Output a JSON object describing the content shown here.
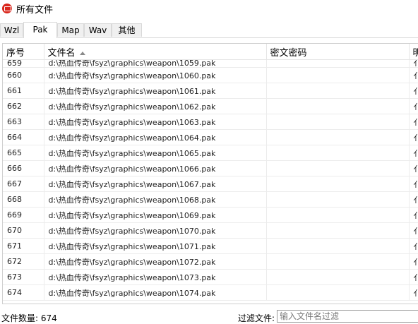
{
  "window": {
    "title": "所有文件",
    "app_icon": "app-logo-icon"
  },
  "tabs": [
    {
      "label": "Wzl",
      "active": false
    },
    {
      "label": "Pak",
      "active": true
    },
    {
      "label": "Map",
      "active": false
    },
    {
      "label": "Wav",
      "active": false
    },
    {
      "label": "其他",
      "active": false
    }
  ],
  "table": {
    "columns": [
      "序号",
      "文件名",
      "密文密码",
      "明"
    ],
    "sort_indicator": "sort-ascending-icon",
    "rows": [
      {
        "index": "659",
        "file": "d:\\热血传奇\\fsyz\\graphics\\weapon\\1059.pak",
        "password": "",
        "extra": "亻"
      },
      {
        "index": "660",
        "file": "d:\\热血传奇\\fsyz\\graphics\\weapon\\1060.pak",
        "password": "",
        "extra": "亻"
      },
      {
        "index": "661",
        "file": "d:\\热血传奇\\fsyz\\graphics\\weapon\\1061.pak",
        "password": "",
        "extra": "亻"
      },
      {
        "index": "662",
        "file": "d:\\热血传奇\\fsyz\\graphics\\weapon\\1062.pak",
        "password": "",
        "extra": "亻"
      },
      {
        "index": "663",
        "file": "d:\\热血传奇\\fsyz\\graphics\\weapon\\1063.pak",
        "password": "",
        "extra": "亻"
      },
      {
        "index": "664",
        "file": "d:\\热血传奇\\fsyz\\graphics\\weapon\\1064.pak",
        "password": "",
        "extra": "亻"
      },
      {
        "index": "665",
        "file": "d:\\热血传奇\\fsyz\\graphics\\weapon\\1065.pak",
        "password": "",
        "extra": "亻"
      },
      {
        "index": "666",
        "file": "d:\\热血传奇\\fsyz\\graphics\\weapon\\1066.pak",
        "password": "",
        "extra": "亻"
      },
      {
        "index": "667",
        "file": "d:\\热血传奇\\fsyz\\graphics\\weapon\\1067.pak",
        "password": "",
        "extra": "亻"
      },
      {
        "index": "668",
        "file": "d:\\热血传奇\\fsyz\\graphics\\weapon\\1068.pak",
        "password": "",
        "extra": "亻"
      },
      {
        "index": "669",
        "file": "d:\\热血传奇\\fsyz\\graphics\\weapon\\1069.pak",
        "password": "",
        "extra": "亻"
      },
      {
        "index": "670",
        "file": "d:\\热血传奇\\fsyz\\graphics\\weapon\\1070.pak",
        "password": "",
        "extra": "亻"
      },
      {
        "index": "671",
        "file": "d:\\热血传奇\\fsyz\\graphics\\weapon\\1071.pak",
        "password": "",
        "extra": "亻"
      },
      {
        "index": "672",
        "file": "d:\\热血传奇\\fsyz\\graphics\\weapon\\1072.pak",
        "password": "",
        "extra": "亻"
      },
      {
        "index": "673",
        "file": "d:\\热血传奇\\fsyz\\graphics\\weapon\\1073.pak",
        "password": "",
        "extra": "亻"
      },
      {
        "index": "674",
        "file": "d:\\热血传奇\\fsyz\\graphics\\weapon\\1074.pak",
        "password": "",
        "extra": "亻"
      }
    ]
  },
  "status": {
    "file_count_label": "文件数量: 674",
    "filter_label": "过滤文件:",
    "filter_placeholder": "输入文件名过滤",
    "filter_value": ""
  }
}
